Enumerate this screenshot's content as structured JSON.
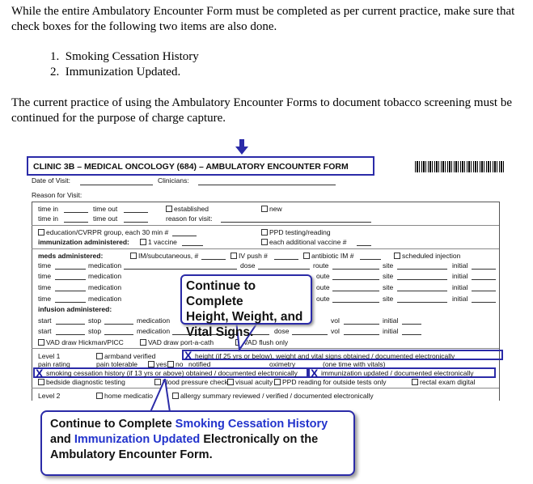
{
  "intro": {
    "paragraph1": "While the entire Ambulatory Encounter Form must be completed as per current practice, make sure that check boxes for the following two items are also done.",
    "items": [
      "1.  Smoking Cessation History",
      "2.  Immunization Updated."
    ],
    "paragraph2": "The current practice of using the Ambulatory Encounter Forms to document tobacco screening must be continued for the purpose of charge capture."
  },
  "form": {
    "title": "CLINIC 3B – MEDICAL ONCOLOGY (684) – AMBULATORY ENCOUNTER FORM",
    "date_of_visit": "Date of Visit:",
    "clinicians": "Clinicians:",
    "reason_for_visit": "Reason for Visit:",
    "time_in": "time in",
    "time_out": "time out",
    "established": "established",
    "new": "new",
    "reason_for_visit_lc": "reason for visit:",
    "education": "education/CVRPR group, each 30 min #",
    "immunization_administered": "immunization administered:",
    "one_vaccine": "1 vaccine",
    "ppd": "PPD testing/reading",
    "each_additional_vaccine": "each additional vaccine #",
    "meds_administered": "meds administered:",
    "im_subcut": "IM/subcutaneous, #",
    "iv_push": "IV push #",
    "antibiotic_im": "antibiotic IM #",
    "scheduled_injection": "scheduled injection",
    "time": "time",
    "medication": "medication",
    "dose": "dose",
    "route": "route",
    "route_partial": "oute",
    "site": "site",
    "initial": "initial",
    "infusion_administered": "infusion administered:",
    "start": "start",
    "stop": "stop",
    "vol": "vol",
    "vad_hickman": "VAD draw Hickman/PICC",
    "vad_port": "VAD draw port-a-cath",
    "vad_flush": "VAD flush only",
    "level1": "Level 1",
    "armband": "armband verified",
    "height_item": "height (if 25 yrs or below), weight and vital signs obtained / documented electronically",
    "pain_rating": "pain rating",
    "pain_tolerable": "pain tolerable",
    "yes": "yes",
    "no": "no",
    "notified": "notified",
    "oximetry": "oximetry",
    "one_time_vitals": "(one time with vitals)",
    "smoking_item": "smoking cessation history (if 13 yrs or above) obtained / documented electronically",
    "immunization_item": "immunization updated / documented electronically",
    "bedside": "bedside diagnostic testing",
    "blood_pressure": "blood pressure check",
    "visual_acuity": "visual acuity",
    "ppd_reading": "PPD reading for outside tests only",
    "rectal": "rectal exam digital",
    "level2": "Level 2",
    "home_medication": "home medicatio",
    "allergy": "allergy summary reviewed / verified / documented electronically",
    "x_mark": "X"
  },
  "callouts": {
    "bubble1_lines": [
      "Continue to Complete",
      "Height, Weight, and",
      "Vital Signs."
    ],
    "bubble2": {
      "part1": "Continue to Complete ",
      "smoking": "Smoking Cessation History",
      "part2": "and ",
      "immunization": "Immunization Updated",
      "part3": " Electronically on the",
      "line3": "Ambulatory Encounter Form."
    }
  },
  "colors": {
    "accent": "#2b2ba8",
    "highlight_text": "#2233cc"
  }
}
